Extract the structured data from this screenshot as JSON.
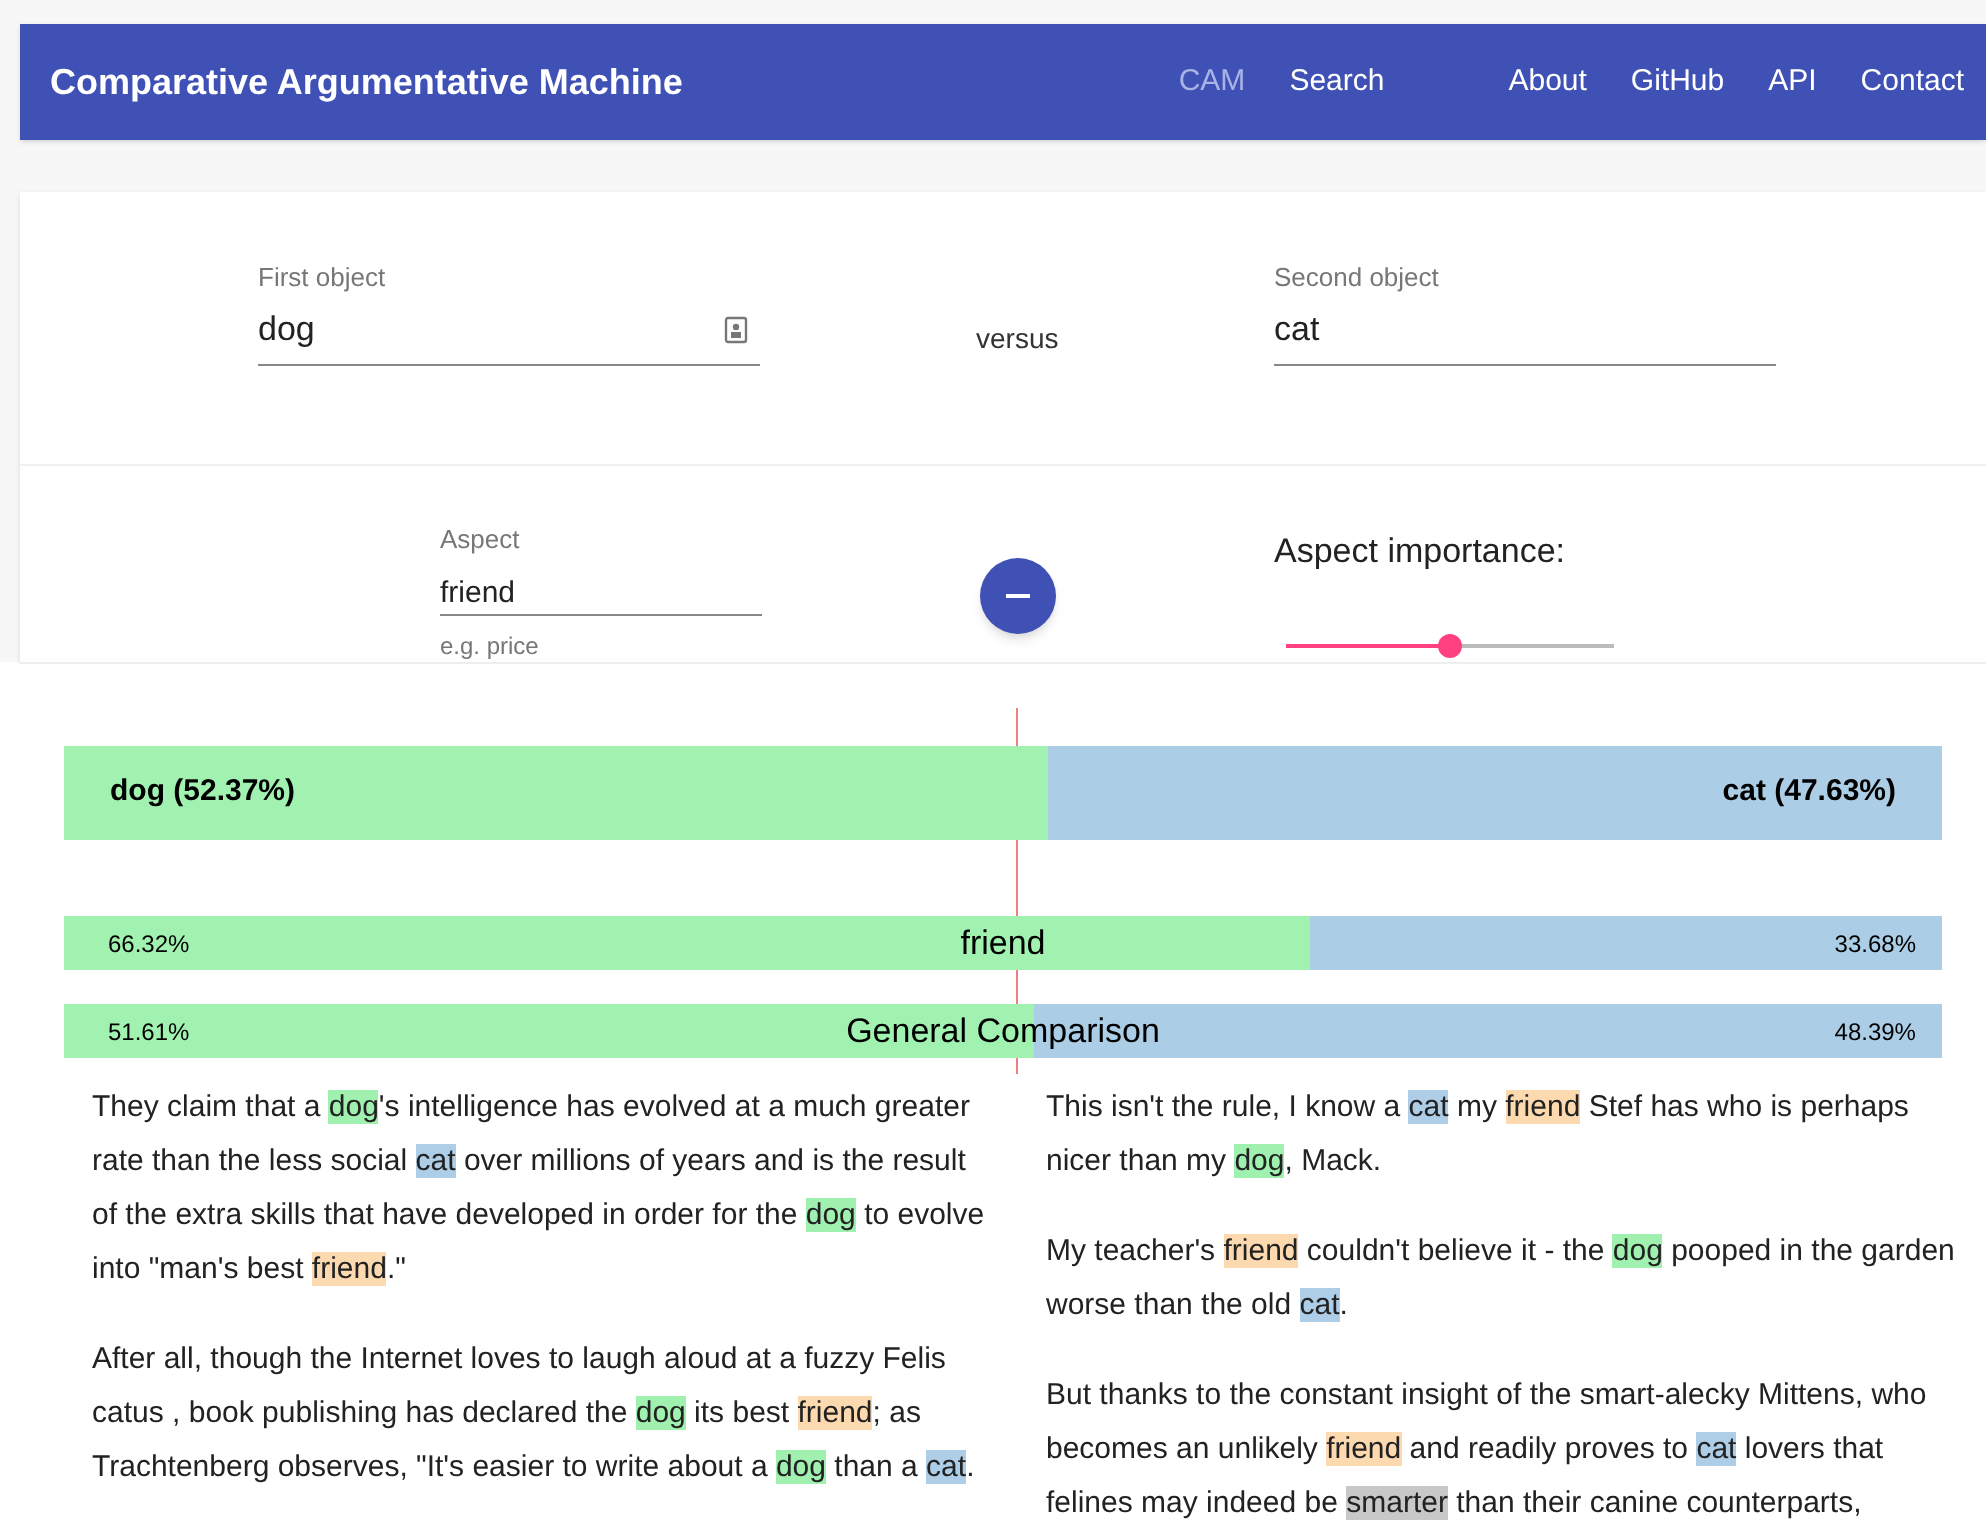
{
  "navbar": {
    "title": "Comparative Argumentative Machine",
    "links": [
      {
        "label": "CAM",
        "selected": true
      },
      {
        "label": "Search",
        "selected": false
      },
      {
        "label": "About",
        "selected": false
      },
      {
        "label": "GitHub",
        "selected": false
      },
      {
        "label": "API",
        "selected": false
      },
      {
        "label": "Contact",
        "selected": false
      }
    ]
  },
  "objects": {
    "first": {
      "label": "First object",
      "value": "dog"
    },
    "versus": "versus",
    "second": {
      "label": "Second object",
      "value": "cat"
    }
  },
  "aspect": {
    "label": "Aspect",
    "value": "friend",
    "hint": "e.g. price",
    "importance_label": "Aspect importance:",
    "level": 0.5
  },
  "result": {
    "first": {
      "label": "dog (52.37%)"
    },
    "second": {
      "label": "cat (47.63%)"
    },
    "level": 0.5237,
    "aspects": [
      {
        "name": "friend",
        "first": "66.32%",
        "second": "33.68%",
        "level": 0.6632
      },
      {
        "name": "General Comparison",
        "first": "51.61%",
        "second": "48.39%",
        "level": 0.5161
      }
    ]
  },
  "sentences": {
    "first": [
      [
        {
          "kind": "plain",
          "text": "They claim that a "
        },
        {
          "kind": "first",
          "text": "dog"
        },
        {
          "kind": "plain",
          "text": "'s intelligence has evolved at a much greater rate than the less social "
        },
        {
          "kind": "second",
          "text": "cat"
        },
        {
          "kind": "plain",
          "text": " over millions of years and is the result of the extra skills that have developed in order for the "
        },
        {
          "kind": "first",
          "text": "dog"
        },
        {
          "kind": "plain",
          "text": " to evolve into \"man's best "
        },
        {
          "kind": "aspect",
          "text": "friend"
        },
        {
          "kind": "plain",
          "text": ".\""
        }
      ],
      [
        {
          "kind": "plain",
          "text": "After all, though the Internet loves to laugh aloud at a fuzzy Felis catus , book publishing has declared the "
        },
        {
          "kind": "first",
          "text": "dog"
        },
        {
          "kind": "plain",
          "text": " its best "
        },
        {
          "kind": "aspect",
          "text": "friend"
        },
        {
          "kind": "plain",
          "text": "; as Trachtenberg observes, \"It's easier to write about a "
        },
        {
          "kind": "first",
          "text": "dog"
        },
        {
          "kind": "plain",
          "text": " than a "
        },
        {
          "kind": "second",
          "text": "cat"
        },
        {
          "kind": "plain",
          "text": "."
        }
      ]
    ],
    "second": [
      [
        {
          "kind": "plain",
          "text": "This isn't the rule, I know a "
        },
        {
          "kind": "second",
          "text": "cat"
        },
        {
          "kind": "plain",
          "text": " my "
        },
        {
          "kind": "aspect",
          "text": "friend"
        },
        {
          "kind": "plain",
          "text": " Stef has who is perhaps nicer than my "
        },
        {
          "kind": "first",
          "text": "dog"
        },
        {
          "kind": "plain",
          "text": ", Mack."
        }
      ],
      [
        {
          "kind": "plain",
          "text": "My teacher's "
        },
        {
          "kind": "aspect",
          "text": "friend"
        },
        {
          "kind": "plain",
          "text": " couldn't believe it - the "
        },
        {
          "kind": "first",
          "text": "dog"
        },
        {
          "kind": "plain",
          "text": " pooped in the garden worse than the old "
        },
        {
          "kind": "second",
          "text": "cat"
        },
        {
          "kind": "plain",
          "text": "."
        }
      ],
      [
        {
          "kind": "plain",
          "text": "But thanks to the constant insight of the smart-alecky Mittens, who becomes an unlikely "
        },
        {
          "kind": "aspect",
          "text": "friend"
        },
        {
          "kind": "plain",
          "text": " and readily proves to "
        },
        {
          "kind": "second",
          "text": "cat"
        },
        {
          "kind": "plain",
          "text": " lovers that felines may indeed be "
        },
        {
          "kind": "marker",
          "text": "smarter"
        },
        {
          "kind": "plain",
          "text": " than their canine counterparts,"
        }
      ]
    ]
  }
}
